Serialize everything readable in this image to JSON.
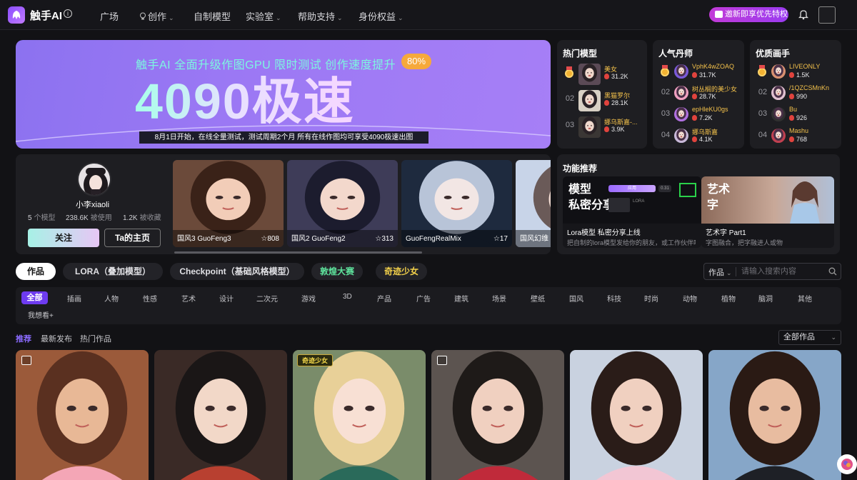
{
  "header": {
    "brand": "触手AI",
    "info_glyph": "i",
    "nav": [
      {
        "label": "广场",
        "caret": false
      },
      {
        "label": "创作",
        "caret": true,
        "icon": "bulb-icon"
      },
      {
        "label": "自制模型",
        "caret": false
      },
      {
        "label": "实验室",
        "caret": true
      },
      {
        "label": "帮助支持",
        "caret": true
      },
      {
        "label": "身份权益",
        "caret": true
      }
    ],
    "vip_button": "邀新即享优先特权",
    "caret_glyph": "⌄"
  },
  "banner": {
    "headline": "触手AI 全面升级作图GPU  限时测试  创作速度提升",
    "percent": "80%",
    "big_text": "4090极速",
    "subtitle": "8月1日开始，在线全量测试，测试周期2个月  所有在线作图均可享受4090极速出图"
  },
  "rankings": [
    {
      "title": "热门模型",
      "kind": "thumb",
      "items": [
        {
          "rank": "1",
          "medal": true,
          "name": "美女",
          "stat": "31.2K",
          "color": "#5b4a56"
        },
        {
          "rank": "02",
          "medal": false,
          "name": "黑猫罗尔",
          "stat": "28.1K",
          "color": "#d8d0c4"
        },
        {
          "rank": "03",
          "medal": false,
          "name": "娜乌斯嘉-...",
          "stat": "3.9K",
          "color": "#3a3634"
        }
      ]
    },
    {
      "title": "人气丹师",
      "kind": "avatar",
      "items": [
        {
          "rank": "1",
          "medal": true,
          "name": "VphK4wZOAQ",
          "stat": "31.7K",
          "color": "#7a5ad8"
        },
        {
          "rank": "02",
          "medal": false,
          "name": "树丛榈的美少女",
          "stat": "28.7K",
          "color": "#f0a0c0"
        },
        {
          "rank": "03",
          "medal": false,
          "name": "epHleKU0gs",
          "stat": "7.2K",
          "color": "#b070e0"
        },
        {
          "rank": "04",
          "medal": false,
          "name": "娜乌斯嘉",
          "stat": "4.1K",
          "color": "#c8b8d8"
        }
      ]
    },
    {
      "title": "优质画手",
      "kind": "avatar",
      "items": [
        {
          "rank": "1",
          "medal": true,
          "name": "LIVEONLY",
          "stat": "1.5K",
          "color": "#d89070"
        },
        {
          "rank": "02",
          "medal": false,
          "name": "/1QZCSMnKn",
          "stat": "990",
          "color": "#e0c0d0"
        },
        {
          "rank": "03",
          "medal": false,
          "name": "Bu",
          "stat": "926",
          "color": "#303030"
        },
        {
          "rank": "04",
          "medal": false,
          "name": "Mashu",
          "stat": "768",
          "color": "#c04050"
        }
      ]
    }
  ],
  "creator": {
    "name": "小李xiaoli",
    "stats": [
      {
        "value": "5",
        "label": "个模型"
      },
      {
        "value": "238.6K",
        "label": "被使用"
      },
      {
        "value": "1.2K",
        "label": "被收藏"
      }
    ],
    "follow": "关注",
    "home": "Ta的主页",
    "models": [
      {
        "name": "国风3 GuoFeng3",
        "stars": "808",
        "show_star": true,
        "bg": "#6b4a3a",
        "face": "#f2cdb8",
        "hair": "#3a2218"
      },
      {
        "name": "国风2 GuoFeng2",
        "stars": "313",
        "show_star": true,
        "bg": "#3e3c58",
        "face": "#f3d8cc",
        "hair": "#1c1c2e"
      },
      {
        "name": "GuoFengRealMix",
        "stars": "17",
        "show_star": true,
        "bg": "#1e2a3e",
        "face": "#f2e6e4",
        "hair": "#b8c4d8"
      },
      {
        "name": "国风幻维",
        "stars": "",
        "show_star": false,
        "bg": "#c8d4e8",
        "face": "#efd9d0",
        "hair": "#6a5a58"
      }
    ],
    "star_glyph": "☆"
  },
  "features": {
    "title": "功能推荐",
    "items": [
      {
        "name": "Lora模型 私密分享上线",
        "desc": "把自制的lora模型发给你的朋友，或工作伙伴吧",
        "big": "模型\n私密分享"
      },
      {
        "name": "艺术字 Part1",
        "desc": "字图融合，把字融进人或物",
        "big": "艺术\n字"
      }
    ],
    "mini_ui": {
      "tab": "应用",
      "btn1": "0.31",
      "btn2": "LORA"
    }
  },
  "main_tabs": [
    "作品",
    "LORA（叠加模型）",
    "Checkpoint（基础风格模型）",
    "敦煌大赛",
    "奇迹少女"
  ],
  "search": {
    "scope": "作品",
    "placeholder": "请输入搜索内容"
  },
  "categories": [
    "全部",
    "插画",
    "人物",
    "性感",
    "艺术",
    "设计",
    "二次元",
    "游戏",
    "3D",
    "产品",
    "广告",
    "建筑",
    "场景",
    "壁纸",
    "国风",
    "科技",
    "时尚",
    "动物",
    "植物",
    "脑洞",
    "其他"
  ],
  "categories_more": "我想看+",
  "sort_tabs": [
    "推荐",
    "最新发布",
    "热门作品"
  ],
  "filter": "全部作品",
  "gallery": [
    {
      "badge": "image-set-icon",
      "tag": "",
      "bg": "#9b5a3a",
      "accent": "#f4a6b6",
      "face": "#e8b896",
      "hair": "#5a3020"
    },
    {
      "badge": "",
      "tag": "",
      "bg": "#3a2a26",
      "accent": "#b84030",
      "face": "#f2d8c8",
      "hair": "#1a1616"
    },
    {
      "badge": "",
      "tag": "奇迹少女",
      "bg": "#7a8c6a",
      "accent": "#2a6a5a",
      "face": "#f8e0d4",
      "hair": "#e8d098"
    },
    {
      "badge": "image-set-icon",
      "tag": "",
      "bg": "#5c5450",
      "accent": "#c02a3a",
      "face": "#f0d0c0",
      "hair": "#1e1a18"
    },
    {
      "badge": "",
      "tag": "",
      "bg": "#c9d2e0",
      "accent": "#f2c6d4",
      "face": "#f0d0c0",
      "hair": "#2a1c18"
    },
    {
      "badge": "",
      "tag": "",
      "bg": "#86a6c8",
      "accent": "#1e2026",
      "face": "#e8bca0",
      "hair": "#2a1a14"
    }
  ],
  "colors": {
    "accent": "#6e3bf0",
    "gold": "#f3c14b",
    "flame": "#e0433d",
    "banner": "#9b78f4"
  }
}
